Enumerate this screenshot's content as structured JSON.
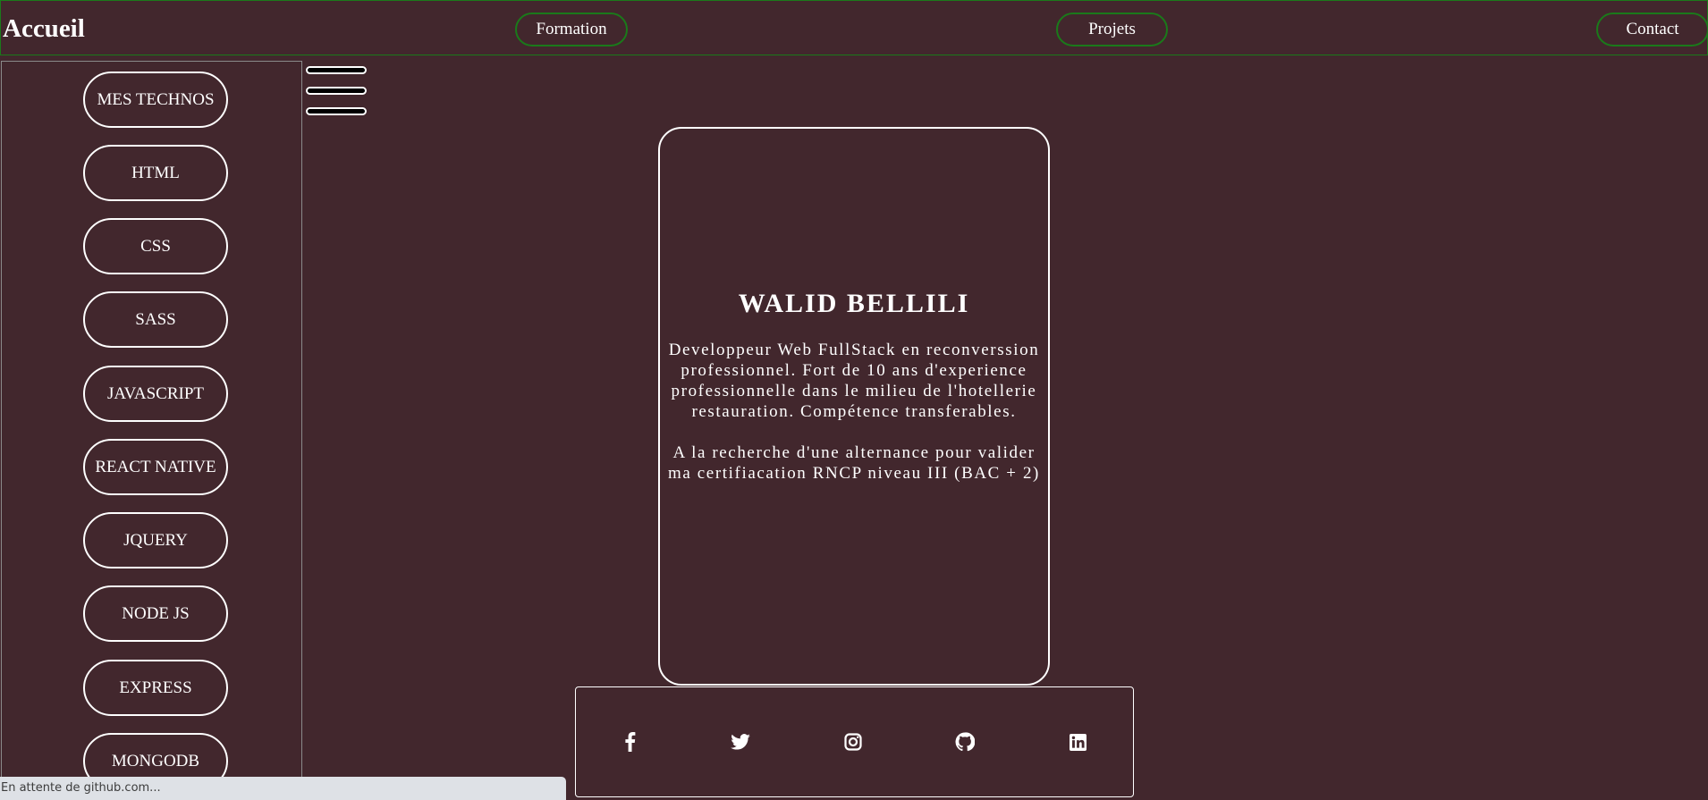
{
  "navbar": {
    "brand": "Accueil",
    "links": [
      "Formation",
      "Projets",
      "Contact"
    ],
    "border_color": "#1a7a1a"
  },
  "sidebar": {
    "items": [
      "MES TECHNOS",
      "HTML",
      "CSS",
      "SASS",
      "JAVASCRIPT",
      "REACT NATIVE",
      "JQUERY",
      "NODE JS",
      "EXPRESS",
      "MONGODB"
    ]
  },
  "menu_toggle": {
    "icon": "hamburger-menu-icon"
  },
  "profile": {
    "name": "WALID BELLILI",
    "bio": "Developpeur Web FullStack en reconverssion professionnel. Fort de 10 ans d'experience professionnelle dans le milieu de l'hotellerie restauration. Compétence transferables.",
    "search": "A la recherche d'une alternance pour valider ma certifiacation RNCP niveau III (BAC + 2)"
  },
  "socials": {
    "icons": [
      "facebook-icon",
      "twitter-icon",
      "instagram-icon",
      "github-icon",
      "linkedin-icon"
    ]
  },
  "status_bar": {
    "text": "En attente de github.com..."
  },
  "colors": {
    "background": "#42272d",
    "text": "#ffffff",
    "accent_border": "#1a7a1a"
  }
}
